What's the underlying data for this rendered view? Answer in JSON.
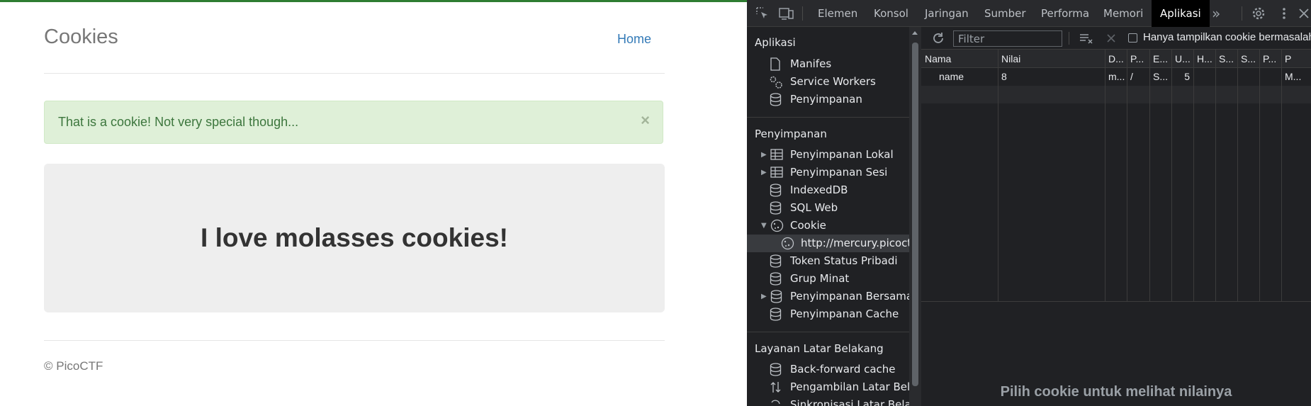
{
  "page": {
    "brand": "Cookies",
    "nav_home": "Home",
    "alert_text": "That is a cookie! Not very special though...",
    "alert_close": "×",
    "jumbotron_title": "I love molasses cookies!",
    "footer": "© PicoCTF"
  },
  "devtools": {
    "tabs": [
      "Elemen",
      "Konsol",
      "Jaringan",
      "Sumber",
      "Performa",
      "Memori",
      "Aplikasi"
    ],
    "active_tab": "Aplikasi",
    "more_tabs": "»",
    "sidebar": {
      "app_title": "Aplikasi",
      "app_items": [
        "Manifes",
        "Service Workers",
        "Penyimpanan"
      ],
      "storage_title": "Penyimpanan",
      "storage_items": [
        "Penyimpanan Lokal",
        "Penyimpanan Sesi",
        "IndexedDB",
        "SQL Web",
        "Cookie",
        "http://mercury.picoctf.net",
        "Token Status Pribadi",
        "Grup Minat",
        "Penyimpanan Bersama",
        "Penyimpanan Cache"
      ],
      "bg_title": "Layanan Latar Belakang",
      "bg_items": [
        "Back-forward cache",
        "Pengambilan Latar Belakang",
        "Sinkronisasi Latar Belakang"
      ]
    },
    "cookies": {
      "filter_placeholder": "Filter",
      "only_issues_label": "Hanya tampilkan cookie bermasalah",
      "columns": [
        "Nama",
        "Nilai",
        "D...",
        "P...",
        "E...",
        "U...",
        "H...",
        "S...",
        "S...",
        "P...",
        "P"
      ],
      "rows": [
        [
          "name",
          "8",
          "m...",
          "/",
          "S...",
          "5",
          "",
          "",
          "",
          "",
          "M..."
        ]
      ],
      "empty_message": "Pilih cookie untuk melihat nilainya"
    }
  }
}
